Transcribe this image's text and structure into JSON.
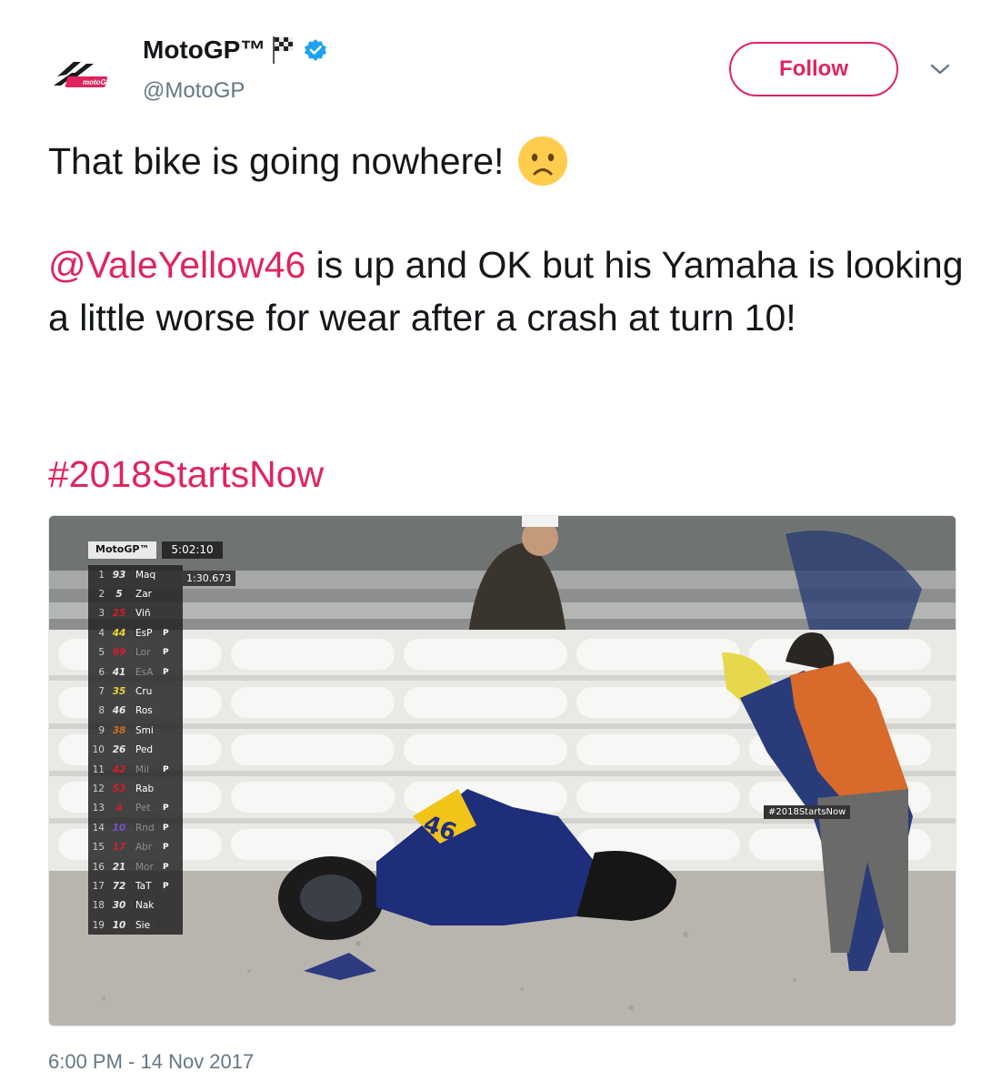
{
  "account": {
    "name": "MotoGP™",
    "handle": "@MotoGP"
  },
  "follow_label": "Follow",
  "tweet": {
    "line1": "That bike is going nowhere!",
    "mention": "@ValeYellow46",
    "para2_rest": " is up and OK but his Yamaha is looking a little worse for wear after a crash at turn 10!",
    "hashtag": "#2018StartsNow"
  },
  "media": {
    "scoreboard_brand": "MotoGP™",
    "scoreboard_clock": "5:02:10",
    "lap_time": "1:30.673",
    "tag": "#2018StartsNow",
    "riders": [
      {
        "pos": "1",
        "num": "93",
        "code": "Maq",
        "pit": "",
        "color": "#e8e8e8",
        "faded": false
      },
      {
        "pos": "2",
        "num": "5",
        "code": "Zar",
        "pit": "",
        "color": "#e8e8e8",
        "faded": false
      },
      {
        "pos": "3",
        "num": "25",
        "code": "Viñ",
        "pit": "",
        "color": "#d11f2a",
        "faded": false
      },
      {
        "pos": "4",
        "num": "44",
        "code": "EsP",
        "pit": "P",
        "color": "#e9d33a",
        "faded": false
      },
      {
        "pos": "5",
        "num": "99",
        "code": "Lor",
        "pit": "P",
        "color": "#d11f2a",
        "faded": true
      },
      {
        "pos": "6",
        "num": "41",
        "code": "EsA",
        "pit": "P",
        "color": "#e8e8e8",
        "faded": true
      },
      {
        "pos": "7",
        "num": "35",
        "code": "Cru",
        "pit": "",
        "color": "#e9d33a",
        "faded": false
      },
      {
        "pos": "8",
        "num": "46",
        "code": "Ros",
        "pit": "",
        "color": "#e8e8e8",
        "faded": false
      },
      {
        "pos": "9",
        "num": "38",
        "code": "Smi",
        "pit": "",
        "color": "#d16d1f",
        "faded": false
      },
      {
        "pos": "10",
        "num": "26",
        "code": "Ped",
        "pit": "",
        "color": "#e8e8e8",
        "faded": false
      },
      {
        "pos": "11",
        "num": "42",
        "code": "Mil",
        "pit": "P",
        "color": "#d11f2a",
        "faded": true
      },
      {
        "pos": "12",
        "num": "53",
        "code": "Rab",
        "pit": "",
        "color": "#d11f2a",
        "faded": false
      },
      {
        "pos": "13",
        "num": "4",
        "code": "Pet",
        "pit": "P",
        "color": "#d11f2a",
        "faded": true
      },
      {
        "pos": "14",
        "num": "10",
        "code": "Rnd",
        "pit": "P",
        "color": "#7d4fc2",
        "faded": true
      },
      {
        "pos": "15",
        "num": "17",
        "code": "Abr",
        "pit": "P",
        "color": "#d11f2a",
        "faded": true
      },
      {
        "pos": "16",
        "num": "21",
        "code": "Mor",
        "pit": "P",
        "color": "#e8e8e8",
        "faded": true
      },
      {
        "pos": "17",
        "num": "72",
        "code": "TaT",
        "pit": "P",
        "color": "#e8e8e8",
        "faded": false
      },
      {
        "pos": "18",
        "num": "30",
        "code": "Nak",
        "pit": "",
        "color": "#e8e8e8",
        "faded": false
      },
      {
        "pos": "19",
        "num": "10",
        "code": "Sie",
        "pit": "",
        "color": "#e8e8e8",
        "faded": false
      }
    ]
  },
  "timestamp": "6:00 PM - 14 Nov 2017",
  "colors": {
    "accent": "#e0245e",
    "verified": "#1da1f2",
    "secondary_text": "#657786"
  },
  "icons": [
    "motogp-logo-icon",
    "checkered-flag-icon",
    "verified-badge-icon",
    "chevron-down-icon",
    "frowning-face-icon"
  ]
}
